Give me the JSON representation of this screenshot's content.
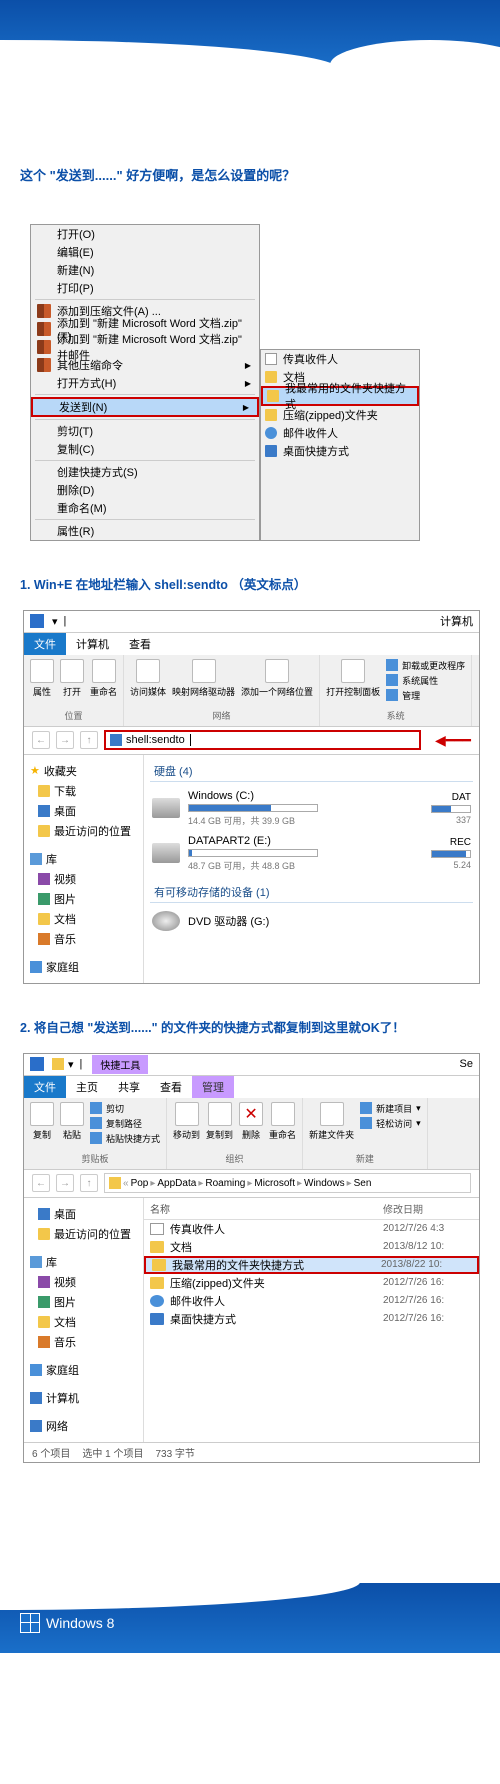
{
  "question": "这个 \"发送到......\" 好方便啊，是怎么设置的呢？",
  "step1": "1. Win+E 在地址栏输入 shell:sendto （英文标点）",
  "step2": "2. 将自己想 \"发送到......\" 的文件夹的快捷方式都复制到这里就OK了！",
  "ctx": {
    "items": [
      {
        "label": "打开(O)"
      },
      {
        "label": "编辑(E)"
      },
      {
        "label": "新建(N)"
      },
      {
        "label": "打印(P)"
      },
      {
        "sep": true
      },
      {
        "label": "添加到压缩文件(A) ...",
        "icon": "book"
      },
      {
        "label": "添加到 \"新建 Microsoft Word 文档.zip\"(T)",
        "icon": "book"
      },
      {
        "label": "添加到 \"新建 Microsoft Word 文档.zip\" 并邮件",
        "icon": "book"
      },
      {
        "label": "其他压缩命令",
        "icon": "book",
        "arrow": true
      },
      {
        "label": "打开方式(H)",
        "arrow": true
      },
      {
        "sep": true
      },
      {
        "label": "发送到(N)",
        "arrow": true,
        "selected": true
      },
      {
        "sep": true
      },
      {
        "label": "剪切(T)"
      },
      {
        "label": "复制(C)"
      },
      {
        "sep": true
      },
      {
        "label": "创建快捷方式(S)"
      },
      {
        "label": "删除(D)"
      },
      {
        "label": "重命名(M)"
      },
      {
        "sep": true
      },
      {
        "label": "属性(R)"
      }
    ],
    "sub": [
      {
        "label": "传真收件人",
        "icon": "doc"
      },
      {
        "label": "文档",
        "icon": "folder"
      },
      {
        "label": "我最常用的文件夹快捷方式",
        "icon": "folder",
        "selected": true
      },
      {
        "label": "压缩(zipped)文件夹",
        "icon": "folder"
      },
      {
        "label": "邮件收件人",
        "icon": "user"
      },
      {
        "label": "桌面快捷方式",
        "icon": "blue"
      }
    ]
  },
  "exp1": {
    "title": "计算机",
    "tabs": {
      "file": "文件",
      "computer": "计算机",
      "view": "查看"
    },
    "ribbon": {
      "props": "属性",
      "open": "打开",
      "rename": "重命名",
      "media": "访问媒体",
      "netdrv": "映射网络驱动器",
      "addnet": "添加一个网络位置",
      "ctrl": "打开控制面板",
      "uninstall": "卸载或更改程序",
      "sysprops": "系统属性",
      "manage": "管理",
      "grp_loc": "位置",
      "grp_net": "网络",
      "grp_sys": "系统"
    },
    "addr": "shell:sendto",
    "side": {
      "fav": "收藏夹",
      "dl": "下载",
      "desk": "桌面",
      "recent": "最近访问的位置",
      "lib": "库",
      "video": "视频",
      "pic": "图片",
      "doc": "文档",
      "music": "音乐",
      "home": "家庭组"
    },
    "main": {
      "hdd": "硬盘 (4)",
      "c": {
        "name": "Windows (C:)",
        "sub": "14.4 GB 可用，共 39.9 GB"
      },
      "e": {
        "name": "DATAPART2 (E:)",
        "sub": "48.7 GB 可用，共 48.8 GB"
      },
      "d": {
        "name": "DAT",
        "sub": "337"
      },
      "rec": {
        "name": "REC",
        "sub": "5.24"
      },
      "removable": "有可移动存储的设备 (1)",
      "dvd": "DVD 驱动器 (G:)"
    }
  },
  "exp2": {
    "tool": "快捷工具",
    "tabs": {
      "file": "文件",
      "home": "主页",
      "share": "共享",
      "view": "查看",
      "manage": "管理"
    },
    "title_suffix": "Se",
    "ribbon": {
      "copy": "复制",
      "paste": "粘贴",
      "cut": "剪切",
      "copypath": "复制路径",
      "pasteshort": "粘贴快捷方式",
      "moveto": "移动到",
      "copyto": "复制到",
      "delete": "删除",
      "rename": "重命名",
      "newfolder": "新建文件夹",
      "newitem": "新建项目",
      "easyaccess": "轻松访问",
      "grp_clip": "剪贴板",
      "grp_org": "组织",
      "grp_new": "新建"
    },
    "breadcrumb": [
      "Pop",
      "AppData",
      "Roaming",
      "Microsoft",
      "Windows",
      "Sen"
    ],
    "cols": {
      "name": "名称",
      "date": "修改日期"
    },
    "files": [
      {
        "name": "传真收件人",
        "date": "2012/7/26 4:3",
        "icon": "doc"
      },
      {
        "name": "文档",
        "date": "2013/8/12 10:",
        "icon": "folder"
      },
      {
        "name": "我最常用的文件夹快捷方式",
        "date": "2013/8/22 10:",
        "icon": "folder",
        "selected": true
      },
      {
        "name": "压缩(zipped)文件夹",
        "date": "2012/7/26 16:",
        "icon": "folder"
      },
      {
        "name": "邮件收件人",
        "date": "2012/7/26 16:",
        "icon": "user"
      },
      {
        "name": "桌面快捷方式",
        "date": "2012/7/26 16:",
        "icon": "blue"
      }
    ],
    "side": {
      "desk": "桌面",
      "recent": "最近访问的位置",
      "lib": "库",
      "video": "视频",
      "pic": "图片",
      "doc": "文档",
      "music": "音乐",
      "home": "家庭组",
      "computer": "计算机",
      "net": "网络"
    },
    "status": {
      "count": "6 个项目",
      "sel": "选中 1 个项目",
      "size": "733 字节"
    }
  },
  "footer": "Windows 8"
}
